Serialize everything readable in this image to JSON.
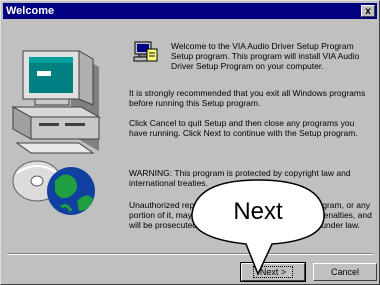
{
  "window": {
    "title": "Welcome",
    "close_glyph": "x"
  },
  "content": {
    "intro": "Welcome to the VIA Audio Driver Setup Program Setup program. This program will install VIA Audio Driver Setup Program on your computer.",
    "recommend": "It is strongly recommended that you exit all Windows programs before running this Setup program.",
    "cancel_note": "Click Cancel to quit Setup and then close any programs you have running. Click Next to continue with the Setup program.",
    "warning": "WARNING: This program is protected by copyright law and international treaties.",
    "unauthorized": "Unauthorized reproduction or distribution of this program, or any portion of it, may result in severe civil and criminal penalties, and will be prosecuted to the maximum extent possible under law."
  },
  "buttons": {
    "next_label": "Next >",
    "cancel_label": "Cancel"
  },
  "callout": {
    "label": "Next"
  },
  "icons": {
    "computer": "computer-icon",
    "setup": "setup-icon",
    "close": "close-icon"
  }
}
